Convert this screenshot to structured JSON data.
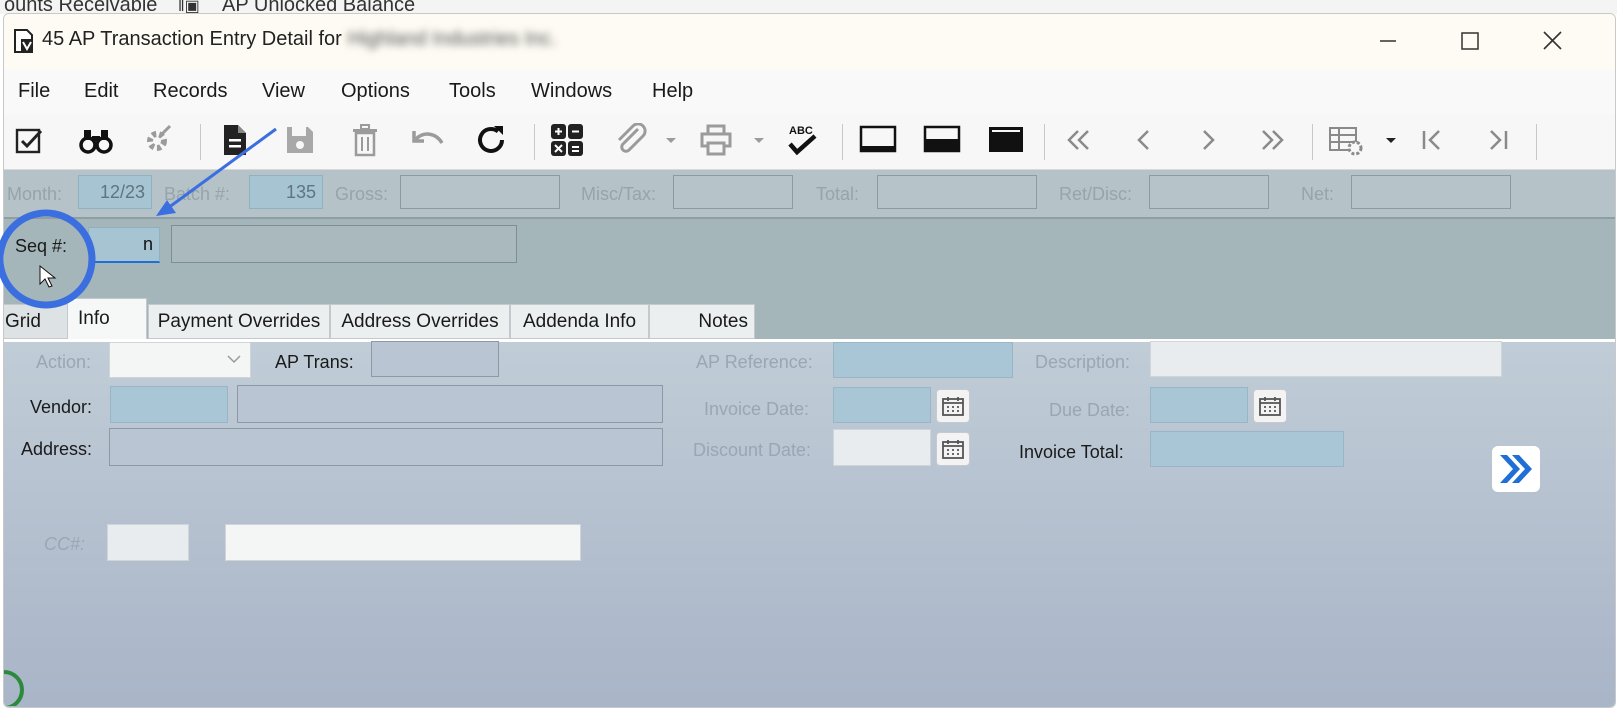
{
  "background_window": {
    "tab1": "ounts Receivable",
    "tab2": "AP Unlocked Balance"
  },
  "window": {
    "title": "45 AP Transaction Entry Detail for",
    "company": "Highland Industries Inc."
  },
  "menu": [
    "File",
    "Edit",
    "Records",
    "View",
    "Options",
    "Tools",
    "Windows",
    "Help"
  ],
  "toolbar_icons": [
    "edit-check-icon",
    "binoculars-icon",
    "gear-icon",
    "new-document-icon",
    "save-icon",
    "delete-icon",
    "undo-icon",
    "refresh-icon",
    "calculator-icon",
    "attach-icon",
    "print-icon",
    "spellcheck-icon",
    "layout-top-icon",
    "layout-middle-icon",
    "layout-full-icon",
    "first-record-icon",
    "previous-record-icon",
    "next-record-icon",
    "last-record-icon",
    "grid-settings-icon",
    "go-first-icon",
    "go-last-icon"
  ],
  "spellcheck_label": "ABC",
  "header": {
    "month_label": "Month:",
    "month_value": "12/23",
    "batch_label": "Batch #:",
    "batch_value": "135",
    "gross_label": "Gross:",
    "misc_label": "Misc/Tax:",
    "total_label": "Total:",
    "ret_label": "Ret/Disc:",
    "net_label": "Net:"
  },
  "seq": {
    "label": "Seq #:",
    "value": "n"
  },
  "tabs": [
    "Grid",
    "Info",
    "Payment Overrides",
    "Address Overrides",
    "Addenda Info",
    "Notes"
  ],
  "tab_grid_visible": "Grid",
  "active_tab": "Info",
  "form": {
    "action_label": "Action:",
    "ap_trans_label": "AP Trans:",
    "vendor_label": "Vendor:",
    "address_label": "Address:",
    "ap_reference_label": "AP Reference:",
    "invoice_date_label": "Invoice Date:",
    "discount_date_label": "Discount Date:",
    "description_label": "Description:",
    "due_date_label": "Due Date:",
    "invoice_total_label": "Invoice Total:",
    "cc_label": "CC#:"
  },
  "colors": {
    "annotation": "#3b6fe0",
    "forward_button": "#1f6fd6"
  }
}
